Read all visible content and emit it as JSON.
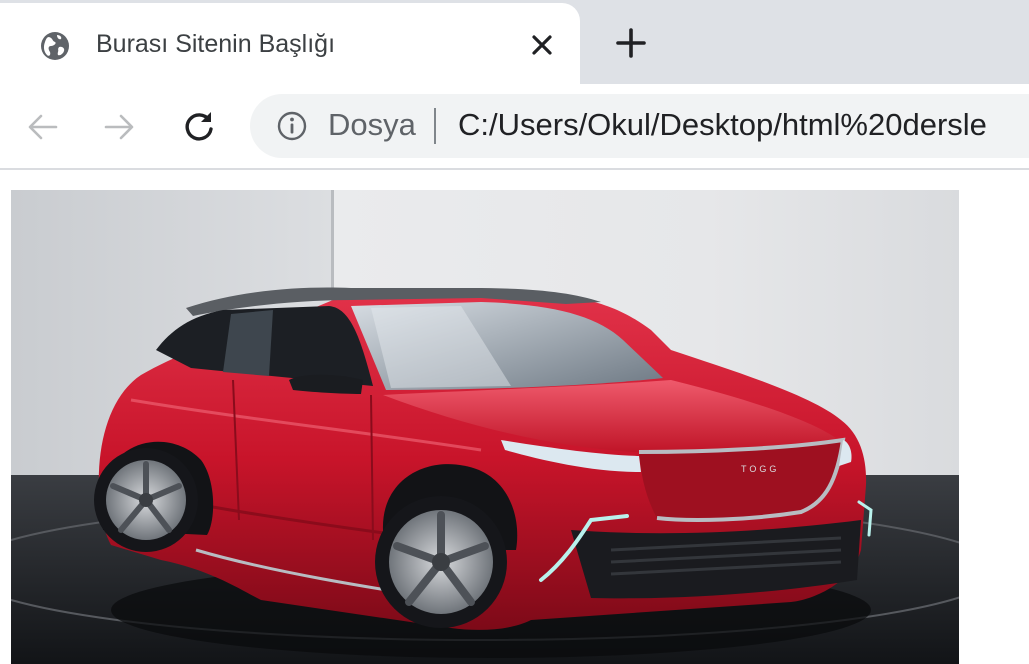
{
  "tab": {
    "title": "Burası Sitenin Başlığı",
    "favicon": "globe-icon",
    "close_icon": "close-icon"
  },
  "new_tab_icon": "plus-icon",
  "toolbar": {
    "back_icon": "arrow-left-icon",
    "forward_icon": "arrow-right-icon",
    "reload_icon": "reload-icon"
  },
  "omnibox": {
    "info_icon": "info-icon",
    "security_label": "Dosya",
    "url": "C:/Users/Okul/Desktop/html%20dersle"
  },
  "page": {
    "image": {
      "subject": "red-suv",
      "badge": "TOGG"
    }
  },
  "colors": {
    "tab_strip": "#dee1e6",
    "omnibox": "#f1f3f4",
    "car_red": "#c8142a"
  }
}
